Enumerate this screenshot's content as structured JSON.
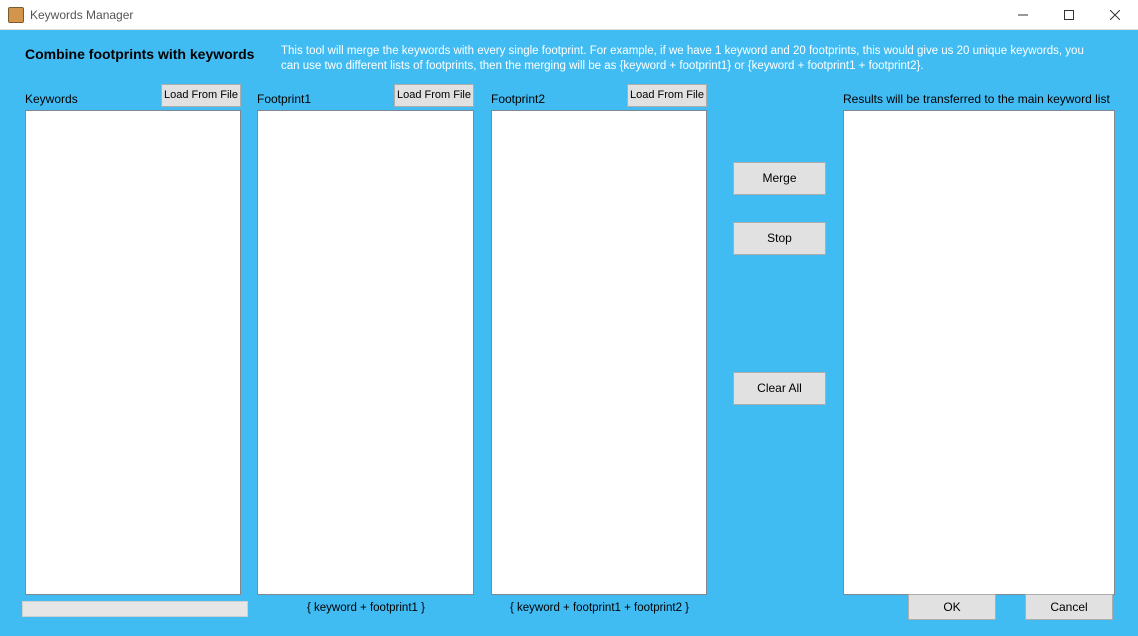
{
  "window": {
    "title": "Keywords Manager"
  },
  "header": {
    "heading": "Combine footprints with keywords",
    "description": "This tool will merge the keywords with every single footprint. For example, if we have 1 keyword and 20 footprints, this would give us 20 unique keywords, you can use two different lists of footprints, then the merging will be as {keyword + footprint1} or {keyword + footprint1 + footprint2}."
  },
  "columns": {
    "keywords": {
      "label": "Keywords",
      "load_btn": "Load From File",
      "value": ""
    },
    "footprint1": {
      "label": "Footprint1",
      "load_btn": "Load From File",
      "value": "",
      "hint": "{ keyword + footprint1 }"
    },
    "footprint2": {
      "label": "Footprint2",
      "load_btn": "Load From File",
      "value": "",
      "hint": "{ keyword + footprint1 + footprint2 }"
    }
  },
  "actions": {
    "merge": "Merge",
    "stop": "Stop",
    "clear_all": "Clear All"
  },
  "results": {
    "label": "Results will be transferred to the main keyword list"
  },
  "dialog": {
    "ok": "OK",
    "cancel": "Cancel"
  }
}
